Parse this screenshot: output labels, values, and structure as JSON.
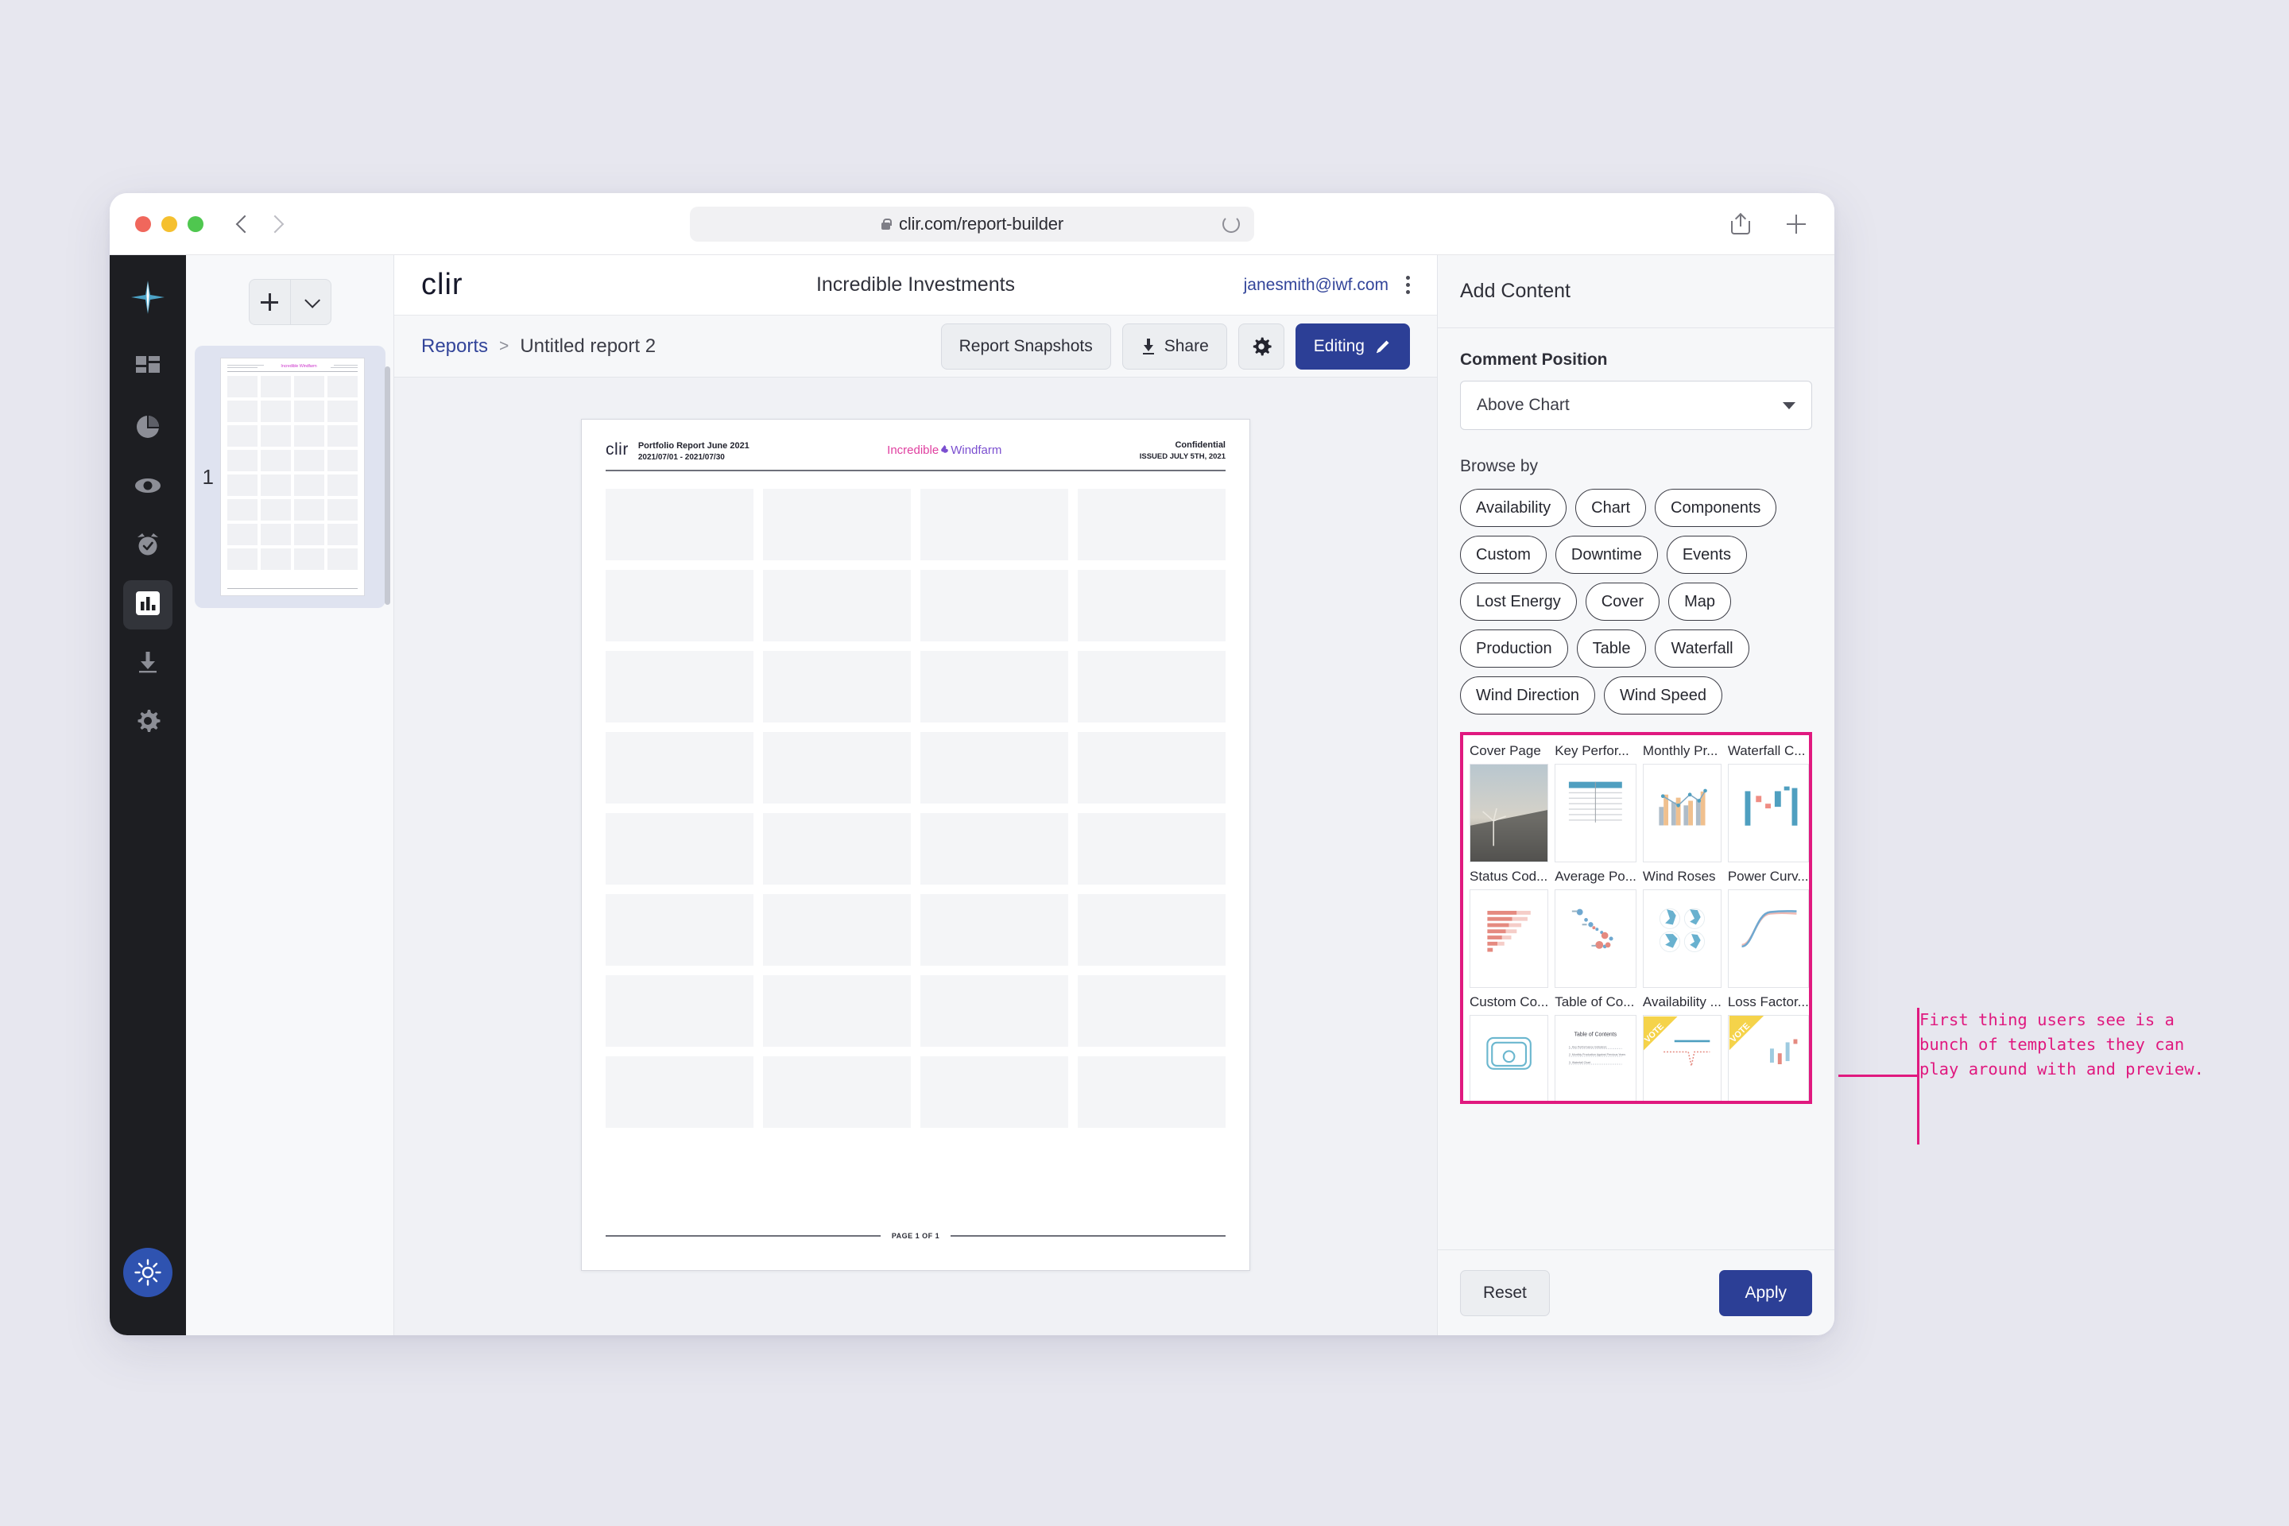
{
  "browser": {
    "url": "clir.com/report-builder",
    "lock_icon": "lock-icon",
    "reload_icon": "reload-icon",
    "back_icon": "chevron-left-icon",
    "forward_icon": "chevron-right-icon",
    "share_icon": "share-icon",
    "newtab_icon": "plus-icon"
  },
  "rail": {
    "logo": "clir-star-logo",
    "items": [
      {
        "name": "sidebar-item-dashboard",
        "icon": "grid-icon",
        "active": false
      },
      {
        "name": "sidebar-item-analytics",
        "icon": "pie-chart-icon",
        "active": false
      },
      {
        "name": "sidebar-item-monitor",
        "icon": "eye-icon",
        "active": false
      },
      {
        "name": "sidebar-item-alerts",
        "icon": "alarm-clock-icon",
        "active": false
      },
      {
        "name": "sidebar-item-reports",
        "icon": "bar-chart-icon",
        "active": true
      },
      {
        "name": "sidebar-item-downloads",
        "icon": "download-icon",
        "active": false
      },
      {
        "name": "sidebar-item-settings",
        "icon": "gear-icon",
        "active": false
      }
    ],
    "theme_toggle_icon": "sun-icon"
  },
  "header": {
    "brand": "clir",
    "title": "Incredible Investments",
    "user_email": "janesmith@iwf.com",
    "menu_icon": "kebab-menu-icon"
  },
  "breadcrumb": {
    "root": "Reports",
    "separator": ">",
    "current": "Untitled report 2"
  },
  "toolbar": {
    "snapshots_label": "Report Snapshots",
    "share_label": "Share",
    "share_icon": "download-share-icon",
    "settings_icon": "gear-icon",
    "editing_label": "Editing",
    "editing_icon": "pencil-icon",
    "primary_color": "#2c3f96"
  },
  "pages_panel": {
    "add_icon": "plus-icon",
    "dropdown_icon": "chevron-down-icon",
    "page_number": "1"
  },
  "report": {
    "logo": "clir",
    "title": "Portfolio  Report June 2021",
    "date_range": "2021/07/01 - 2021/07/30",
    "center_brand_1": "Incredible",
    "center_brand_2": "Windfarm",
    "confidential": "Confidential",
    "issued": "ISSUED JULY 5TH, 2021",
    "footer": "PAGE 1 OF 1",
    "grid_rows": 8,
    "grid_cols": 4
  },
  "inspector": {
    "title": "Add Content",
    "comment_position_label": "Comment Position",
    "comment_position_value": "Above Chart",
    "browse_by_label": "Browse by",
    "chips": [
      "Availability",
      "Chart",
      "Components",
      "Custom",
      "Downtime",
      "Events",
      "Lost Energy",
      "Cover",
      "Map",
      "Production",
      "Table",
      "Waterfall",
      "Wind Direction",
      "Wind Speed"
    ],
    "templates": [
      {
        "name": "Cover Page",
        "thumb": "photo-windturbine"
      },
      {
        "name": "Key Perfor...",
        "thumb": "table-kpi"
      },
      {
        "name": "Monthly Pr...",
        "thumb": "bar-line-combo"
      },
      {
        "name": "Waterfall C...",
        "thumb": "waterfall"
      },
      {
        "name": "Status Cod...",
        "thumb": "horizontal-bars"
      },
      {
        "name": "Average Po...",
        "thumb": "scatter"
      },
      {
        "name": "Wind Roses",
        "thumb": "wind-roses"
      },
      {
        "name": "Power Curv...",
        "thumb": "power-curve"
      },
      {
        "name": "Custom Co...",
        "thumb": "custom-comment"
      },
      {
        "name": "Table of Co...",
        "thumb": "table-of-contents"
      },
      {
        "name": "Availability ...",
        "thumb": "availability-vote"
      },
      {
        "name": "Loss Factor...",
        "thumb": "loss-factor-vote"
      }
    ],
    "toc_title": "Table of Contents",
    "vote_ribbon": "VOTE",
    "reset_label": "Reset",
    "apply_label": "Apply",
    "highlight_color": "#e0197f"
  },
  "annotation": {
    "text": "First thing users see is a bunch of templates they can play around with and preview.",
    "color": "#e0197f"
  }
}
